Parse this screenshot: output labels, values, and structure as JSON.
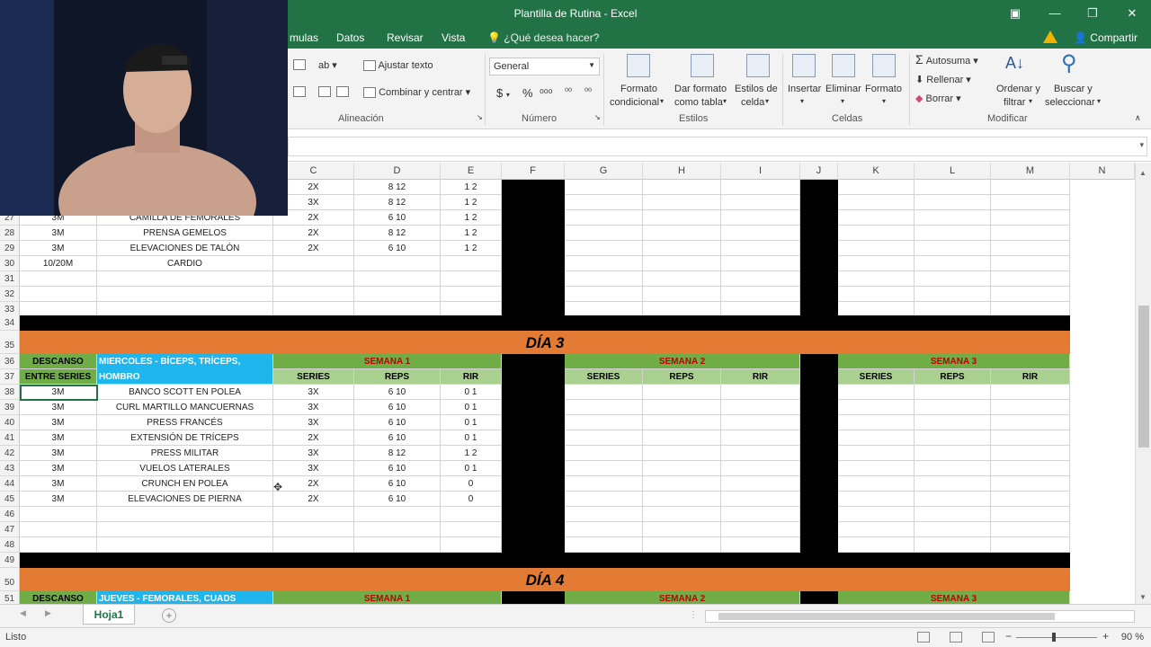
{
  "window": {
    "title": "Plantilla de Rutina - Excel"
  },
  "tabs": [
    {
      "label": "mulas"
    },
    {
      "label": "Datos"
    },
    {
      "label": "Revisar"
    },
    {
      "label": "Vista"
    }
  ],
  "tell_me": "¿Qué desea hacer?",
  "share": "Compartir",
  "ribbon": {
    "alineacion": {
      "wrap": "Ajustar texto",
      "merge": "Combinar y centrar",
      "label": "Alineación"
    },
    "numero": {
      "format": "General",
      "currency": "$",
      "percent": "%",
      "label": "Número"
    },
    "estilos": {
      "cond1": "Formato",
      "cond2": "condicional",
      "table1": "Dar formato",
      "table2": "como tabla",
      "cell1": "Estilos de",
      "cell2": "celda",
      "label": "Estilos"
    },
    "celdas": {
      "insert": "Insertar",
      "delete": "Eliminar",
      "format": "Formato",
      "label": "Celdas"
    },
    "modificar": {
      "autosum": "Autosuma",
      "fill": "Rellenar",
      "clear": "Borrar",
      "sort1": "Ordenar y",
      "sort2": "filtrar",
      "find1": "Buscar y",
      "find2": "seleccionar",
      "label": "Modificar"
    }
  },
  "columns": [
    "C",
    "D",
    "E",
    "F",
    "G",
    "H",
    "I",
    "J",
    "K",
    "L",
    "M",
    "N"
  ],
  "rows_top": [
    {
      "num": "",
      "a": "",
      "b": "",
      "c": "2X",
      "d": "8 12",
      "e": "1 2"
    },
    {
      "num": "",
      "a": "",
      "b": "",
      "c": "3X",
      "d": "8 12",
      "e": "1 2"
    },
    {
      "num": "27",
      "a": "3M",
      "b": "CAMILLA DE FEMORALES",
      "c": "2X",
      "d": "6 10",
      "e": "1 2"
    },
    {
      "num": "28",
      "a": "3M",
      "b": "PRENSA GEMELOS",
      "c": "2X",
      "d": "8 12",
      "e": "1 2"
    },
    {
      "num": "29",
      "a": "3M",
      "b": "ELEVACIONES DE TALÓN",
      "c": "2X",
      "d": "6 10",
      "e": "1 2"
    },
    {
      "num": "30",
      "a": "10/20M",
      "b": "CARDIO",
      "c": "",
      "d": "",
      "e": ""
    },
    {
      "num": "31",
      "a": "",
      "b": "",
      "c": "",
      "d": "",
      "e": ""
    },
    {
      "num": "32",
      "a": "",
      "b": "",
      "c": "",
      "d": "",
      "e": ""
    },
    {
      "num": "33",
      "a": "",
      "b": "",
      "c": "",
      "d": "",
      "e": ""
    }
  ],
  "dia3": {
    "title": "DÍA 3",
    "rownums": [
      "34",
      "35",
      "36",
      "37"
    ],
    "descanso": "DESCANSO",
    "entre": "ENTRE SERIES",
    "day_label": "MIERCOLES - BÍCEPS, TRÍCEPS, HOMBRO",
    "semana1": "SEMANA 1",
    "semana2": "SEMANA 2",
    "semana3": "SEMANA 3",
    "series": "SERIES",
    "reps": "REPS",
    "rir": "RIR"
  },
  "rows_dia3": [
    {
      "num": "38",
      "a": "3M",
      "b": "BANCO SCOTT EN POLEA",
      "c": "3X",
      "d": "6 10",
      "e": "0 1"
    },
    {
      "num": "39",
      "a": "3M",
      "b": "CURL MARTILLO MANCUERNAS",
      "c": "3X",
      "d": "6 10",
      "e": "0 1"
    },
    {
      "num": "40",
      "a": "3M",
      "b": "PRESS FRANCÉS",
      "c": "3X",
      "d": "6 10",
      "e": "0 1"
    },
    {
      "num": "41",
      "a": "3M",
      "b": "EXTENSIÓN DE TRÍCEPS",
      "c": "2X",
      "d": "6 10",
      "e": "0 1"
    },
    {
      "num": "42",
      "a": "3M",
      "b": "PRESS MILITAR",
      "c": "3X",
      "d": "8 12",
      "e": "1 2"
    },
    {
      "num": "43",
      "a": "3M",
      "b": "VUELOS LATERALES",
      "c": "3X",
      "d": "6 10",
      "e": "0 1"
    },
    {
      "num": "44",
      "a": "3M",
      "b": "CRUNCH EN POLEA",
      "c": "2X",
      "d": "6 10",
      "e": "0"
    },
    {
      "num": "45",
      "a": "3M",
      "b": "ELEVACIONES DE PIERNA",
      "c": "2X",
      "d": "6 10",
      "e": "0"
    },
    {
      "num": "46",
      "a": "",
      "b": "",
      "c": "",
      "d": "",
      "e": ""
    },
    {
      "num": "47",
      "a": "",
      "b": "",
      "c": "",
      "d": "",
      "e": ""
    },
    {
      "num": "48",
      "a": "",
      "b": "",
      "c": "",
      "d": "",
      "e": ""
    }
  ],
  "dia4": {
    "title": "DÍA 4",
    "rownums": [
      "49",
      "50",
      "51"
    ],
    "descanso": "DESCANSO",
    "day_label": "JUEVES - FEMORALES, CUADS",
    "semana1": "SEMANA 1",
    "semana2": "SEMANA 2",
    "semana3": "SEMANA 3"
  },
  "sheet_tab": "Hoja1",
  "status": {
    "text": "Listo",
    "zoom": "90 %"
  }
}
